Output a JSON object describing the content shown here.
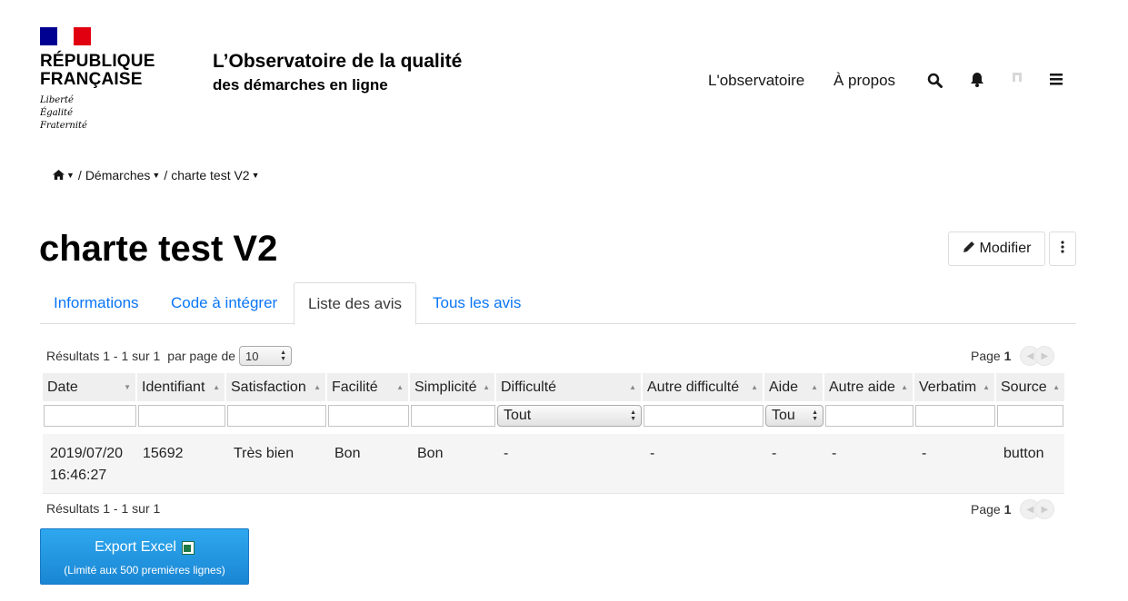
{
  "header": {
    "republic_name_line1": "RÉPUBLIQUE",
    "republic_name_line2": "FRANÇAISE",
    "motto_1": "Liberté",
    "motto_2": "Égalité",
    "motto_3": "Fraternité",
    "site_title_1": "L’Observatoire de la qualité",
    "site_title_2": "des démarches en ligne",
    "nav": {
      "observatoire": "L'observatoire",
      "apropos": "À propos",
      "search_icon": "search-icon",
      "bell_icon": "bell-icon",
      "user_icon": "user-icon",
      "menu_icon": "menu-icon"
    },
    "flag_colors": [
      "#000091",
      "#ffffff",
      "#e1000f"
    ]
  },
  "breadcrumb": {
    "home_icon": "home-icon",
    "items": [
      "Démarches",
      "charte test V2"
    ],
    "separator": "/"
  },
  "page": {
    "title": "charte test V2",
    "modifier_label": "Modifier",
    "more_icon": "vertical-dots-icon"
  },
  "tabs": [
    {
      "label": "Informations",
      "active": false
    },
    {
      "label": "Code à intégrer",
      "active": false
    },
    {
      "label": "Liste des avis",
      "active": true
    },
    {
      "label": "Tous les avis",
      "active": false
    }
  ],
  "pager": {
    "results_top": "Résultats 1 - 1 sur 1",
    "per_page_label": "par page de",
    "per_page_value": "10",
    "page_label": "Page",
    "page_number": "1",
    "results_bottom": "Résultats 1 - 1 sur 1"
  },
  "table": {
    "columns": [
      "Date",
      "Identifiant",
      "Satisfaction",
      "Facilité",
      "Simplicité",
      "Difficulté",
      "Autre difficulté",
      "Aide",
      "Autre aide",
      "Verbatim",
      "Source"
    ],
    "filter_selects": {
      "difficulte": "Tout",
      "aide": "Tou"
    },
    "rows": [
      {
        "date_line1": "2019/07/20",
        "date_line2": "16:46:27",
        "identifiant": "15692",
        "satisfaction": "Très bien",
        "facilite": "Bon",
        "simplicite": "Bon",
        "difficulte": "-",
        "autre_difficulte": "-",
        "aide": "-",
        "autre_aide": "-",
        "verbatim": "-",
        "source": "button"
      }
    ]
  },
  "export": {
    "label": "Export Excel",
    "sublabel": "(Limité aux 500 premières lignes)",
    "icon": "excel-icon"
  },
  "colors": {
    "link_blue": "#0a76f6",
    "export_blue": "#1f93e0"
  }
}
